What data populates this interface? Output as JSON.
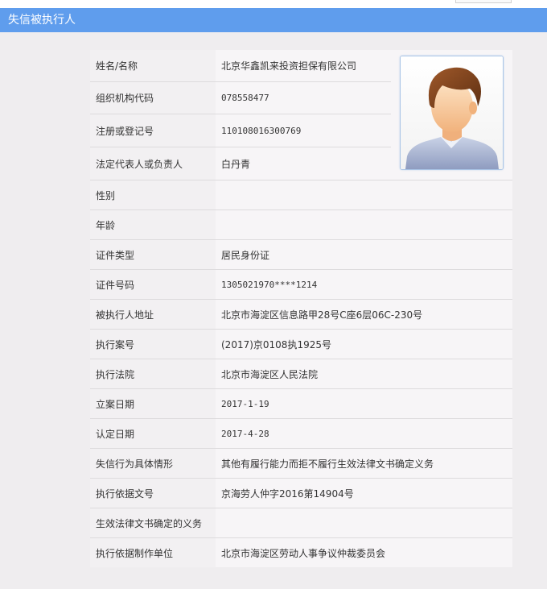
{
  "header": {
    "title": "失信被执行人"
  },
  "rows": [
    {
      "label": "姓名/名称",
      "value": "北京华鑫凯来投资担保有限公司"
    },
    {
      "label": "组织机构代码",
      "value": "078558477"
    },
    {
      "label": "注册或登记号",
      "value": "110108016300769"
    },
    {
      "label": "法定代表人或负责人",
      "value": "白丹青"
    },
    {
      "label": "性别",
      "value": ""
    },
    {
      "label": "年龄",
      "value": ""
    },
    {
      "label": "证件类型",
      "value": "居民身份证"
    },
    {
      "label": "证件号码",
      "value": "1305021970****1214"
    },
    {
      "label": "被执行人地址",
      "value": "北京市海淀区信息路甲28号C座6层06C-230号"
    },
    {
      "label": "执行案号",
      "value": "(2017)京0108执1925号"
    },
    {
      "label": "执行法院",
      "value": "北京市海淀区人民法院"
    },
    {
      "label": "立案日期",
      "value": "2017-1-19"
    },
    {
      "label": "认定日期",
      "value": "2017-4-28"
    },
    {
      "label": "失信行为具体情形",
      "value": "其他有履行能力而拒不履行生效法律文书确定义务"
    },
    {
      "label": "执行依据文号",
      "value": "京海劳人仲字2016第14904号"
    },
    {
      "label": "生效法律文书确定的义务",
      "value": ""
    },
    {
      "label": "执行依据制作单位",
      "value": "北京市海淀区劳动人事争议仲裁委员会"
    }
  ],
  "photo": {
    "icon": "person-avatar-icon"
  },
  "colors": {
    "header_bg": "#5f9ded",
    "page_bg": "#efedef",
    "label_bg": "#f2f0f2",
    "value_bg": "#f7f5f7",
    "photo_border": "#a9c4e6"
  }
}
